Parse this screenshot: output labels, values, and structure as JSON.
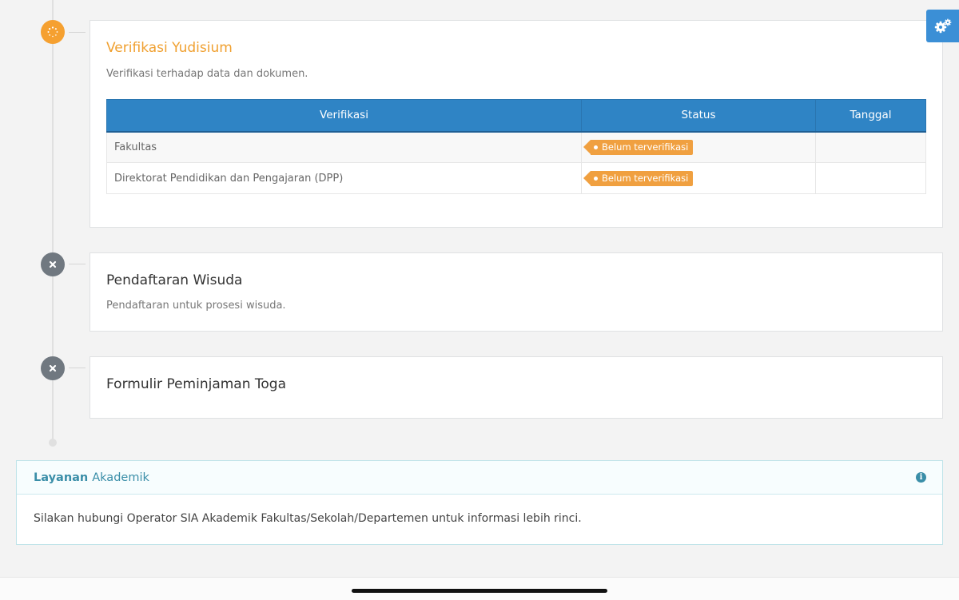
{
  "steps": [
    {
      "title": "Verifikasi Yudisium",
      "description": "Verifikasi terhadap data dan dokumen.",
      "table": {
        "headers": [
          "Verifikasi",
          "Status",
          "Tanggal"
        ],
        "rows": [
          {
            "verifikasi": "Fakultas",
            "status": "Belum terverifikasi",
            "tanggal": ""
          },
          {
            "verifikasi": "Direktorat Pendidikan dan Pengajaran (DPP)",
            "status": "Belum terverifikasi",
            "tanggal": ""
          }
        ]
      },
      "state": "in-progress"
    },
    {
      "title": "Pendaftaran Wisuda",
      "description": "Pendaftaran untuk prosesi wisuda.",
      "state": "blocked"
    },
    {
      "title": "Formulir Peminjaman Toga",
      "state": "blocked"
    }
  ],
  "info_panel": {
    "title_bold": "Layanan",
    "title_rest": "Akademik",
    "body": "Silakan hubungi Operator SIA Akademik Fakultas/Sekolah/Departemen untuk informasi lebih rinci.",
    "icon": "info-icon"
  },
  "settings_button": {
    "icon": "gears-icon"
  },
  "colors": {
    "accent_orange": "#f0a030",
    "header_blue": "#2f84c5",
    "node_gray": "#707880",
    "info_teal": "#3a8ea8"
  }
}
